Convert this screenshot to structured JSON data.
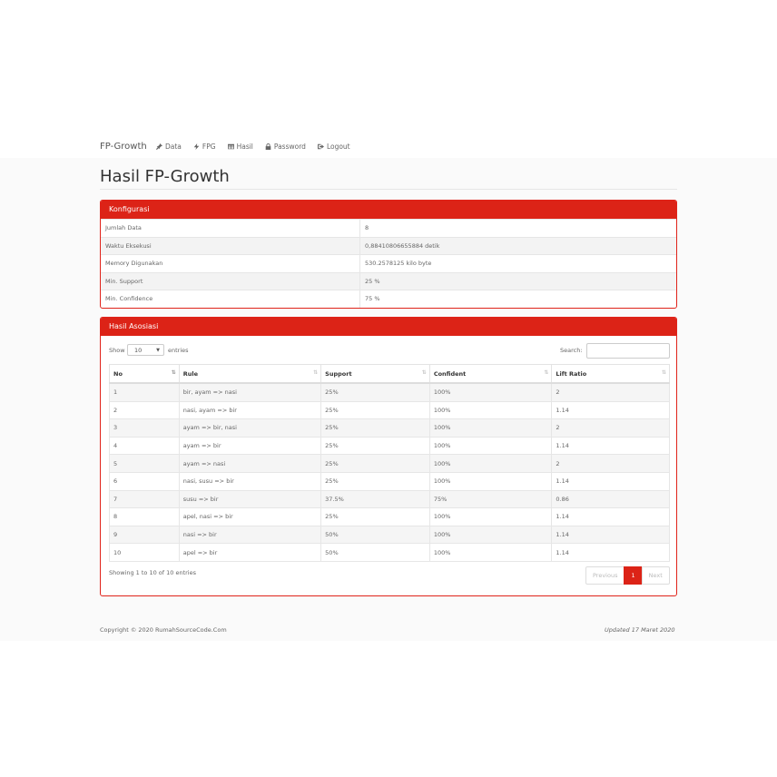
{
  "navbar": {
    "brand": "FP-Growth",
    "items": [
      {
        "label": "Data",
        "icon": "pin-icon"
      },
      {
        "label": "FPG",
        "icon": "bolt-icon"
      },
      {
        "label": "Hasil",
        "icon": "table-icon"
      },
      {
        "label": "Password",
        "icon": "lock-icon"
      },
      {
        "label": "Logout",
        "icon": "logout-icon"
      }
    ]
  },
  "page": {
    "title": "Hasil FP-Growth"
  },
  "konfigurasi": {
    "heading": "Konfigurasi",
    "rows": [
      {
        "key": "Jumlah Data",
        "value": "8"
      },
      {
        "key": "Waktu Eksekusi",
        "value": "0,88410806655884 detik"
      },
      {
        "key": "Memory Digunakan",
        "value": "530.2578125 kilo byte"
      },
      {
        "key": "Min. Support",
        "value": "25 %"
      },
      {
        "key": "Min. Confidence",
        "value": "75 %"
      }
    ]
  },
  "hasil": {
    "heading": "Hasil Asosiasi",
    "show_label": "Show",
    "page_size": "10",
    "entries_label": "entries",
    "search_label": "Search:",
    "search_value": "",
    "columns": [
      "No",
      "Rule",
      "Support",
      "Confident",
      "Lift Ratio"
    ],
    "rows": [
      [
        "1",
        "bir, ayam => nasi",
        "25%",
        "100%",
        "2"
      ],
      [
        "2",
        "nasi, ayam => bir",
        "25%",
        "100%",
        "1.14"
      ],
      [
        "3",
        "ayam => bir, nasi",
        "25%",
        "100%",
        "2"
      ],
      [
        "4",
        "ayam => bir",
        "25%",
        "100%",
        "1.14"
      ],
      [
        "5",
        "ayam => nasi",
        "25%",
        "100%",
        "2"
      ],
      [
        "6",
        "nasi, susu => bir",
        "25%",
        "100%",
        "1.14"
      ],
      [
        "7",
        "susu => bir",
        "37.5%",
        "75%",
        "0.86"
      ],
      [
        "8",
        "apel, nasi => bir",
        "25%",
        "100%",
        "1.14"
      ],
      [
        "9",
        "nasi => bir",
        "50%",
        "100%",
        "1.14"
      ],
      [
        "10",
        "apel => bir",
        "50%",
        "100%",
        "1.14"
      ]
    ],
    "info": "Showing 1 to 10 of 10 entries",
    "pager": {
      "previous": "Previous",
      "current": "1",
      "next": "Next"
    }
  },
  "footer": {
    "copyright": "Copyright © 2020 RumahSourceCode.Com",
    "updated": "Updated 17 Maret 2020"
  },
  "colors": {
    "accent": "#dc2317",
    "panel_border": "#e0231a"
  }
}
